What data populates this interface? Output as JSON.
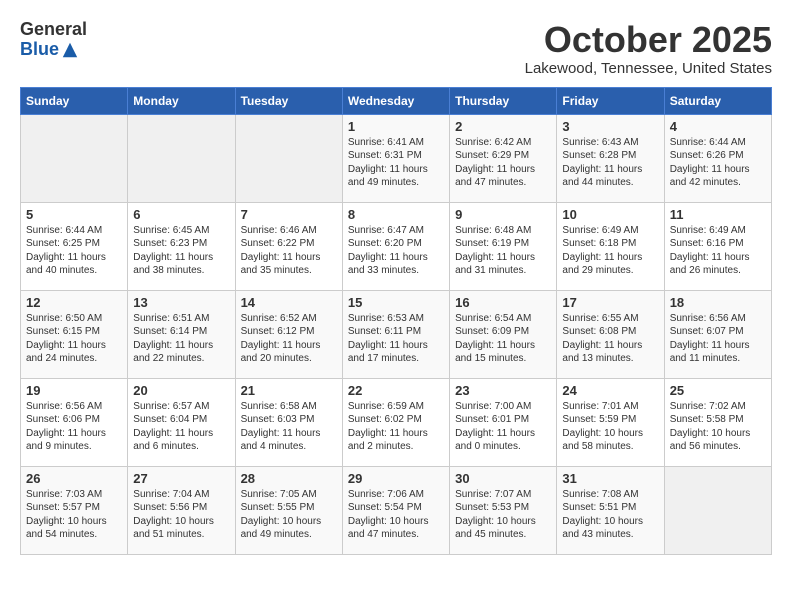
{
  "header": {
    "logo": {
      "general": "General",
      "blue": "Blue"
    },
    "title": "October 2025",
    "location": "Lakewood, Tennessee, United States"
  },
  "weekdays": [
    "Sunday",
    "Monday",
    "Tuesday",
    "Wednesday",
    "Thursday",
    "Friday",
    "Saturday"
  ],
  "weeks": [
    [
      {
        "day": "",
        "content": ""
      },
      {
        "day": "",
        "content": ""
      },
      {
        "day": "",
        "content": ""
      },
      {
        "day": "1",
        "content": "Sunrise: 6:41 AM\nSunset: 6:31 PM\nDaylight: 11 hours\nand 49 minutes."
      },
      {
        "day": "2",
        "content": "Sunrise: 6:42 AM\nSunset: 6:29 PM\nDaylight: 11 hours\nand 47 minutes."
      },
      {
        "day": "3",
        "content": "Sunrise: 6:43 AM\nSunset: 6:28 PM\nDaylight: 11 hours\nand 44 minutes."
      },
      {
        "day": "4",
        "content": "Sunrise: 6:44 AM\nSunset: 6:26 PM\nDaylight: 11 hours\nand 42 minutes."
      }
    ],
    [
      {
        "day": "5",
        "content": "Sunrise: 6:44 AM\nSunset: 6:25 PM\nDaylight: 11 hours\nand 40 minutes."
      },
      {
        "day": "6",
        "content": "Sunrise: 6:45 AM\nSunset: 6:23 PM\nDaylight: 11 hours\nand 38 minutes."
      },
      {
        "day": "7",
        "content": "Sunrise: 6:46 AM\nSunset: 6:22 PM\nDaylight: 11 hours\nand 35 minutes."
      },
      {
        "day": "8",
        "content": "Sunrise: 6:47 AM\nSunset: 6:20 PM\nDaylight: 11 hours\nand 33 minutes."
      },
      {
        "day": "9",
        "content": "Sunrise: 6:48 AM\nSunset: 6:19 PM\nDaylight: 11 hours\nand 31 minutes."
      },
      {
        "day": "10",
        "content": "Sunrise: 6:49 AM\nSunset: 6:18 PM\nDaylight: 11 hours\nand 29 minutes."
      },
      {
        "day": "11",
        "content": "Sunrise: 6:49 AM\nSunset: 6:16 PM\nDaylight: 11 hours\nand 26 minutes."
      }
    ],
    [
      {
        "day": "12",
        "content": "Sunrise: 6:50 AM\nSunset: 6:15 PM\nDaylight: 11 hours\nand 24 minutes."
      },
      {
        "day": "13",
        "content": "Sunrise: 6:51 AM\nSunset: 6:14 PM\nDaylight: 11 hours\nand 22 minutes."
      },
      {
        "day": "14",
        "content": "Sunrise: 6:52 AM\nSunset: 6:12 PM\nDaylight: 11 hours\nand 20 minutes."
      },
      {
        "day": "15",
        "content": "Sunrise: 6:53 AM\nSunset: 6:11 PM\nDaylight: 11 hours\nand 17 minutes."
      },
      {
        "day": "16",
        "content": "Sunrise: 6:54 AM\nSunset: 6:09 PM\nDaylight: 11 hours\nand 15 minutes."
      },
      {
        "day": "17",
        "content": "Sunrise: 6:55 AM\nSunset: 6:08 PM\nDaylight: 11 hours\nand 13 minutes."
      },
      {
        "day": "18",
        "content": "Sunrise: 6:56 AM\nSunset: 6:07 PM\nDaylight: 11 hours\nand 11 minutes."
      }
    ],
    [
      {
        "day": "19",
        "content": "Sunrise: 6:56 AM\nSunset: 6:06 PM\nDaylight: 11 hours\nand 9 minutes."
      },
      {
        "day": "20",
        "content": "Sunrise: 6:57 AM\nSunset: 6:04 PM\nDaylight: 11 hours\nand 6 minutes."
      },
      {
        "day": "21",
        "content": "Sunrise: 6:58 AM\nSunset: 6:03 PM\nDaylight: 11 hours\nand 4 minutes."
      },
      {
        "day": "22",
        "content": "Sunrise: 6:59 AM\nSunset: 6:02 PM\nDaylight: 11 hours\nand 2 minutes."
      },
      {
        "day": "23",
        "content": "Sunrise: 7:00 AM\nSunset: 6:01 PM\nDaylight: 11 hours\nand 0 minutes."
      },
      {
        "day": "24",
        "content": "Sunrise: 7:01 AM\nSunset: 5:59 PM\nDaylight: 10 hours\nand 58 minutes."
      },
      {
        "day": "25",
        "content": "Sunrise: 7:02 AM\nSunset: 5:58 PM\nDaylight: 10 hours\nand 56 minutes."
      }
    ],
    [
      {
        "day": "26",
        "content": "Sunrise: 7:03 AM\nSunset: 5:57 PM\nDaylight: 10 hours\nand 54 minutes."
      },
      {
        "day": "27",
        "content": "Sunrise: 7:04 AM\nSunset: 5:56 PM\nDaylight: 10 hours\nand 51 minutes."
      },
      {
        "day": "28",
        "content": "Sunrise: 7:05 AM\nSunset: 5:55 PM\nDaylight: 10 hours\nand 49 minutes."
      },
      {
        "day": "29",
        "content": "Sunrise: 7:06 AM\nSunset: 5:54 PM\nDaylight: 10 hours\nand 47 minutes."
      },
      {
        "day": "30",
        "content": "Sunrise: 7:07 AM\nSunset: 5:53 PM\nDaylight: 10 hours\nand 45 minutes."
      },
      {
        "day": "31",
        "content": "Sunrise: 7:08 AM\nSunset: 5:51 PM\nDaylight: 10 hours\nand 43 minutes."
      },
      {
        "day": "",
        "content": ""
      }
    ]
  ]
}
